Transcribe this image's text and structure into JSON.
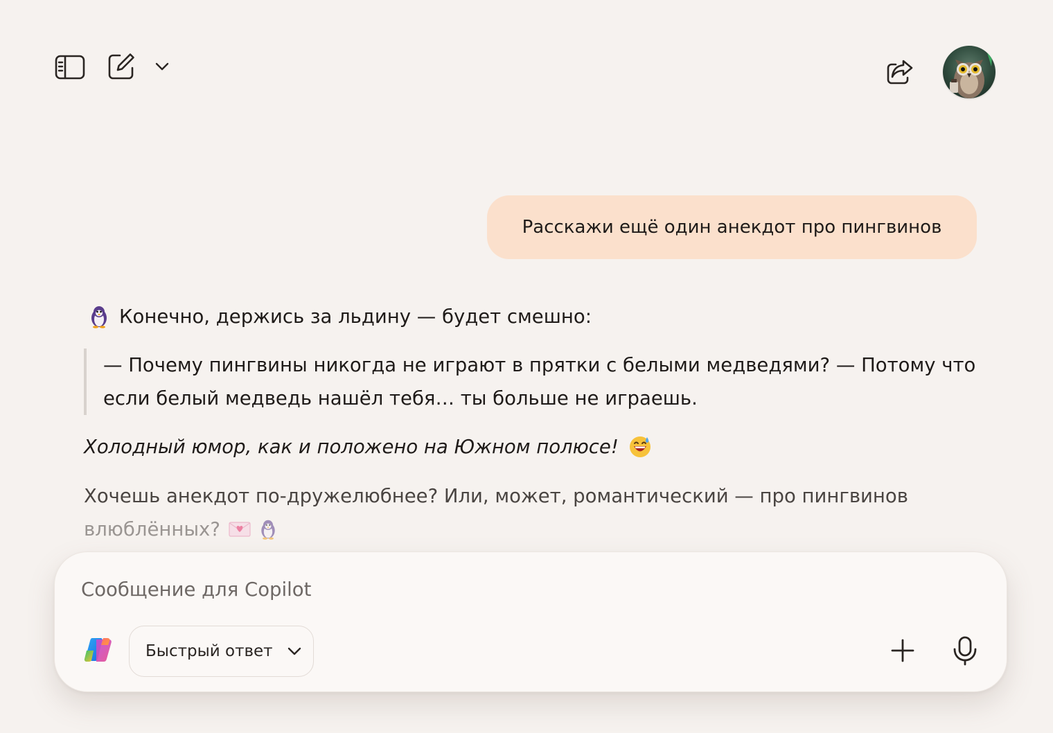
{
  "toolbar": {
    "sidebar_icon": "sidebar-toggle-icon",
    "new_chat_icon": "compose-icon",
    "chat_menu_icon": "chevron-down-icon",
    "share_icon": "share-icon"
  },
  "user": {
    "avatar_icon": "owl-avatar"
  },
  "conversation": {
    "user_message": "Расскажи ещё один анекдот про пингвинов",
    "assistant": {
      "intro": "Конечно, держись за льдину — будет смешно:",
      "quote_line_1": "— Почему пингвины никогда не играют в прятки с белыми медведями? — Потому что",
      "quote_line_2": "если белый медведь нашёл тебя… ты больше не играешь.",
      "italic_line": "Холодный юмор, как и положено на Южном полюсе!",
      "followup_line_1": "Хочешь анекдот по-дружелюбнее? Или, может, романтический — про пингвинов",
      "followup_line_2": "влюблённых?"
    },
    "emoji_icons": [
      "penguin-emoji",
      "grinning-sweat-emoji",
      "love-letter-emoji"
    ]
  },
  "composer": {
    "placeholder": "Сообщение для Copilot",
    "value": "",
    "mode_label": "Быстрый ответ",
    "logo_icon": "copilot-logo",
    "attach_icon": "plus-icon",
    "mic_icon": "microphone-icon"
  },
  "colors": {
    "background": "#f6f2ef",
    "user_bubble": "#fbe0cc",
    "composer": "#fbf8f6",
    "text": "#1f1b19"
  }
}
